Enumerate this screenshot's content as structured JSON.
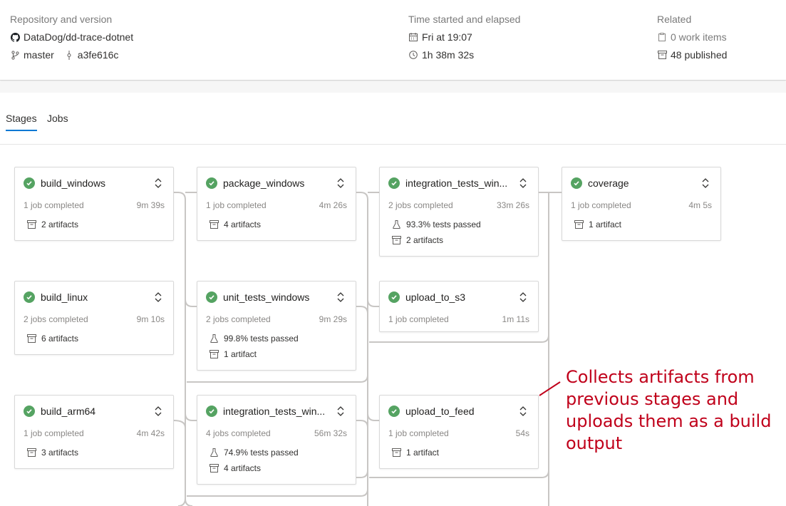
{
  "summary": {
    "repo_heading": "Repository and version",
    "repo_name": "DataDog/dd-trace-dotnet",
    "branch": "master",
    "commit": "a3fe616c",
    "time_heading": "Time started and elapsed",
    "started": "Fri at 19:07",
    "elapsed": "1h 38m 32s",
    "related_heading": "Related",
    "work_items": "0 work items",
    "published": "48 published"
  },
  "tabs": {
    "stages": "Stages",
    "jobs": "Jobs"
  },
  "stages": [
    {
      "name": "build_windows",
      "jobs": "1 job completed",
      "duration": "9m 39s",
      "artifacts": "2 artifacts",
      "tests": null
    },
    {
      "name": "build_linux",
      "jobs": "2 jobs completed",
      "duration": "9m 10s",
      "artifacts": "6 artifacts",
      "tests": null
    },
    {
      "name": "build_arm64",
      "jobs": "1 job completed",
      "duration": "4m 42s",
      "artifacts": "3 artifacts",
      "tests": null
    },
    {
      "name": "package_windows",
      "jobs": "1 job completed",
      "duration": "4m 26s",
      "artifacts": "4 artifacts",
      "tests": null
    },
    {
      "name": "unit_tests_windows",
      "jobs": "2 jobs completed",
      "duration": "9m 29s",
      "artifacts": "1 artifact",
      "tests": "99.8% tests passed"
    },
    {
      "name": "integration_tests_win...",
      "jobs": "4 jobs completed",
      "duration": "56m 32s",
      "artifacts": "4 artifacts",
      "tests": "74.9% tests passed"
    },
    {
      "name": "integration_tests_win...",
      "jobs": "2 jobs completed",
      "duration": "33m 26s",
      "artifacts": "2 artifacts",
      "tests": "93.3% tests passed"
    },
    {
      "name": "upload_to_s3",
      "jobs": "1 job completed",
      "duration": "1m 11s",
      "artifacts": null,
      "tests": null
    },
    {
      "name": "upload_to_feed",
      "jobs": "1 job completed",
      "duration": "54s",
      "artifacts": "1 artifact",
      "tests": null
    },
    {
      "name": "coverage",
      "jobs": "1 job completed",
      "duration": "4m 5s",
      "artifacts": "1 artifact",
      "tests": null
    }
  ],
  "annotation": {
    "text": "Collects artifacts from previous stages and uploads them as a build output",
    "color": "#c0001a"
  },
  "colors": {
    "success": "#55a362",
    "tab_accent": "#0078d4"
  }
}
